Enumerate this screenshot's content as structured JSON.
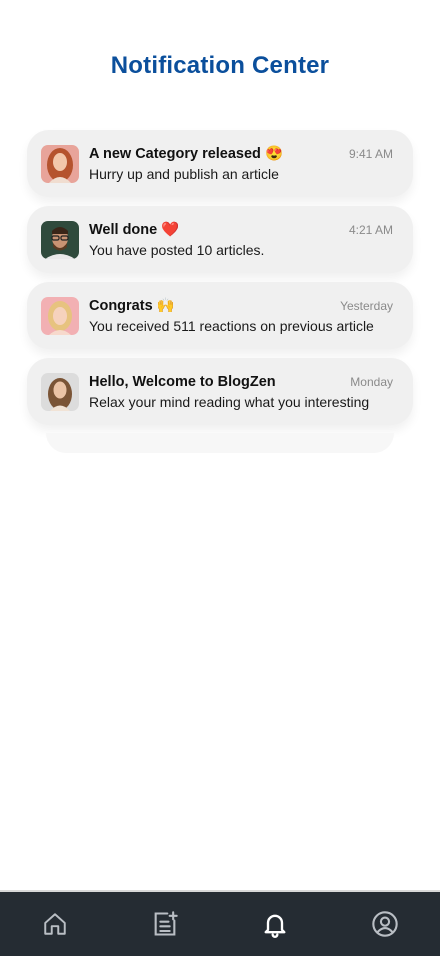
{
  "header": {
    "title": "Notification Center"
  },
  "notifications": [
    {
      "title": "A new Category released 😍",
      "time": "9:41 AM",
      "body": "Hurry up and publish an article",
      "avatar": "woman-red-hair-avatar"
    },
    {
      "title": "Well done ❤️",
      "time": "4:21 AM",
      "body": "You have posted 10 articles.",
      "avatar": "man-glasses-avatar"
    },
    {
      "title": "Congrats 🙌",
      "time": "Yesterday",
      "body": "You received 511 reactions on previous article",
      "avatar": "woman-blonde-avatar"
    },
    {
      "title": "Hello, Welcome to BlogZen",
      "time": "Monday",
      "body": "Relax your mind reading what you interesting",
      "avatar": "woman-brown-hair-avatar"
    }
  ],
  "nav": {
    "items": [
      {
        "icon": "home-icon",
        "active": false
      },
      {
        "icon": "new-article-icon",
        "active": false
      },
      {
        "icon": "bell-icon",
        "active": true
      },
      {
        "icon": "profile-icon",
        "active": false
      }
    ]
  },
  "colors": {
    "title": "#0b4f9c",
    "card": "#f0f0f0",
    "nav_bg": "#252c33",
    "nav_icon": "#b9bec4",
    "nav_active": "#ffffff"
  }
}
